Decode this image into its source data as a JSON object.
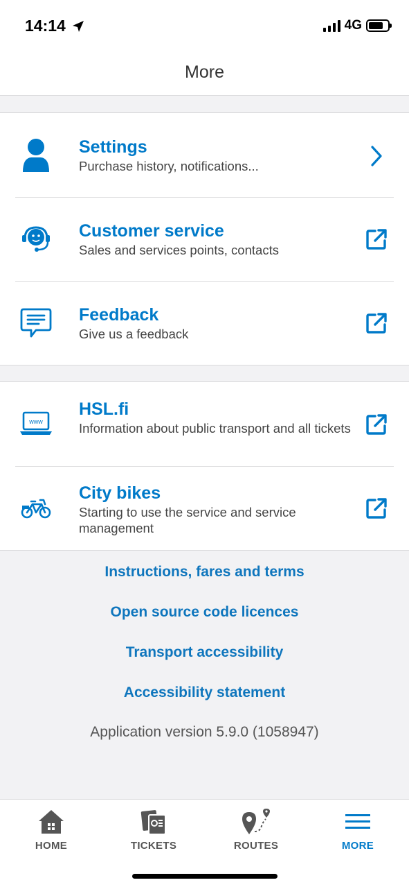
{
  "status": {
    "time": "14:14",
    "network": "4G"
  },
  "header": {
    "title": "More"
  },
  "groups": [
    {
      "items": [
        {
          "title": "Settings",
          "subtitle": "Purchase history, notifications...",
          "icon": "person-icon",
          "action": "chevron-right-icon"
        },
        {
          "title": "Customer service",
          "subtitle": "Sales and services points, contacts",
          "icon": "headset-icon",
          "action": "external-link-icon"
        },
        {
          "title": "Feedback",
          "subtitle": "Give us a feedback",
          "icon": "chat-bubble-icon",
          "action": "external-link-icon"
        }
      ]
    },
    {
      "items": [
        {
          "title": "HSL.fi",
          "subtitle": "Information about public transport and all tickets",
          "icon": "laptop-www-icon",
          "action": "external-link-icon"
        },
        {
          "title": "City bikes",
          "subtitle": "Starting to use the service and service management",
          "icon": "bike-icon",
          "action": "external-link-icon"
        }
      ]
    }
  ],
  "links": [
    "Instructions, fares and terms",
    "Open source code licences",
    "Transport accessibility",
    "Accessibility statement"
  ],
  "version": "Application version 5.9.0  (1058947)",
  "tabs": [
    {
      "label": "HOME",
      "icon": "home-icon",
      "active": false
    },
    {
      "label": "TICKETS",
      "icon": "tickets-icon",
      "active": false
    },
    {
      "label": "ROUTES",
      "icon": "routes-icon",
      "active": false
    },
    {
      "label": "MORE",
      "icon": "menu-icon",
      "active": true
    }
  ],
  "colors": {
    "accent": "#007ac9",
    "background": "#f2f2f4",
    "text": "#333333"
  }
}
